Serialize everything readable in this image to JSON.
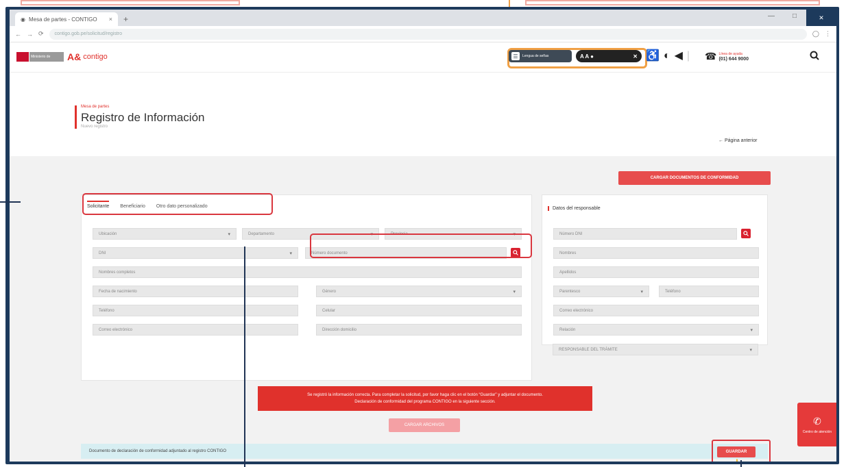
{
  "browser": {
    "tab_title": "Mesa de partes - CONTIGO",
    "new_tab": "+",
    "tab_close": "×",
    "url": "contigo.gob.pe/solicitud/registro",
    "nav_back": "←",
    "nav_forward": "→",
    "nav_reload": "⟳",
    "minimize": "—",
    "maximize": "□",
    "close": "✕"
  },
  "header": {
    "logo_text": "Ministerio de Desarrollo e Inclusión Social",
    "brand_mark": "A&",
    "brand_name": "contigo",
    "sign_language_btn": "Lengua de señas",
    "accessibility_btn": "A A ●",
    "accessibility_icon": "♿",
    "contrast_icon": "◐",
    "audio_icon": "◀",
    "separator": "|",
    "phone_icon": "☎",
    "help_label": "Línea de ayuda",
    "help_number": "(01) 644 9000",
    "search_icon": "search-icon"
  },
  "page": {
    "pre_title": "Mesa de partes",
    "title": "Registro de Información",
    "subtitle": "Nuevo registro",
    "back_link": "← Página anterior"
  },
  "actions": {
    "top_button": "CARGAR DOCUMENTOS DE CONFORMIDAD",
    "alert_line1": "Se registró la información correcta. Para completar la solicitud, por favor haga clic en el botón “Guardar” y adjuntar el documento.",
    "alert_line2": "Declaración de conformidad del programa CONTIGO en la siguiente sección.",
    "pink_button": "CARGAR ARCHIVOS",
    "info_text": "Documento de declaración de conformidad adjuntado al registro CONTIGO",
    "save_button": "GUARDAR"
  },
  "form": {
    "tabs": [
      "Solicitante",
      "Beneficiario",
      "Otro dato personalizado"
    ],
    "row1": [
      "Ubicación",
      "Departamento",
      "Provincia"
    ],
    "row2": [
      "DNI",
      "Número documento"
    ],
    "row3": [
      "Nombres completos"
    ],
    "row4": [
      "Fecha de nacimiento",
      "Género"
    ],
    "row5": [
      "Teléfono",
      "Celular"
    ],
    "row6": [
      "Correo electrónico",
      "Dirección domicilio"
    ]
  },
  "side": {
    "title": "Datos del responsable",
    "fields": [
      "Número DNI",
      "Nombres",
      "Apellidos",
      "Parentesco",
      "Teléfono",
      "Correo electrónico",
      "Relación",
      "RESPONSABLE DEL TRÁMITE"
    ]
  },
  "float_help": {
    "label": "Centro de atención"
  }
}
